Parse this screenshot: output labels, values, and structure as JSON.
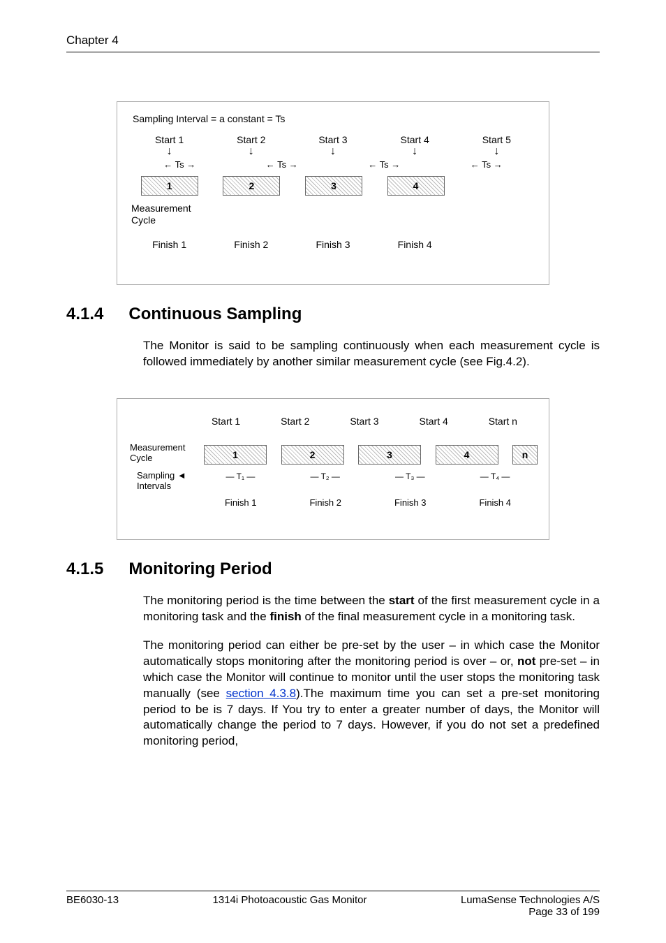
{
  "header": {
    "chapter": "Chapter 4"
  },
  "fig1": {
    "top_label": "Sampling Interval = a constant = Ts",
    "start_labels": [
      "Start 1",
      "Start 2",
      "Start 3",
      "Start 4",
      "Start 5"
    ],
    "interval_glyph": "Ts",
    "ts_row": [
      "Ts",
      "Ts",
      "Ts",
      "Ts"
    ],
    "arrow_row": [
      "↓",
      "↓",
      "↓",
      "↓",
      "↓"
    ],
    "blocks": [
      "1",
      "2",
      "3",
      "4"
    ],
    "mcycle1": "Measurement",
    "mcycle2": "Cycle",
    "finish_labels": [
      "Finish 1",
      "Finish 2",
      "Finish 3",
      "Finish 4"
    ]
  },
  "section_414": {
    "number": "4.1.4",
    "title": "Continuous Sampling",
    "para": "The Monitor is said to be sampling continuously when each measurement cycle is followed immediately by another similar measurement cycle (see Fig.4.2)."
  },
  "fig2": {
    "start_labels": [
      "Start 1",
      "Start 2",
      "Start 3",
      "Start 4",
      "Start n"
    ],
    "blocks": [
      "1",
      "2",
      "3",
      "4",
      "n"
    ],
    "mcycle1": "Measurement",
    "mcycle2": "Cycle",
    "sampling1": "Sampling",
    "sampling2": "Intervals",
    "t_row": [
      "T₁",
      "T₂",
      "T₃",
      "T₄"
    ],
    "finish_labels": [
      "Finish 1",
      "Finish 2",
      "Finish 3",
      "Finish 4"
    ]
  },
  "section_415": {
    "number": "4.1.5",
    "title": "Monitoring Period",
    "para1_a": "The monitoring period is the time between the ",
    "para1_b": "start",
    "para1_c": " of the first measurement cycle in a monitoring task and the ",
    "para1_d": "finish",
    "para1_e": " of the final measurement cycle in a monitoring task.",
    "para2_a": "The monitoring period can either be pre-set by the user – in which case the Monitor automatically stops monitoring after the monitoring period is over – or, ",
    "para2_b": "not",
    "para2_c": " pre-set – in which case the Monitor will continue to monitor until the user stops the monitoring task manually (see ",
    "para2_link": "section 4.3.8",
    "para2_d": ").The maximum time you can set a pre-set monitoring period to be is 7 days. If You try to enter a greater number of days, the Monitor will automatically change the period to 7 days. However, if you do not set a predefined monitoring period,"
  },
  "footer": {
    "left": "BE6030-13",
    "center": "1314i Photoacoustic Gas Monitor",
    "right1": "LumaSense Technologies A/S",
    "right2": "Page 33 of 199"
  }
}
